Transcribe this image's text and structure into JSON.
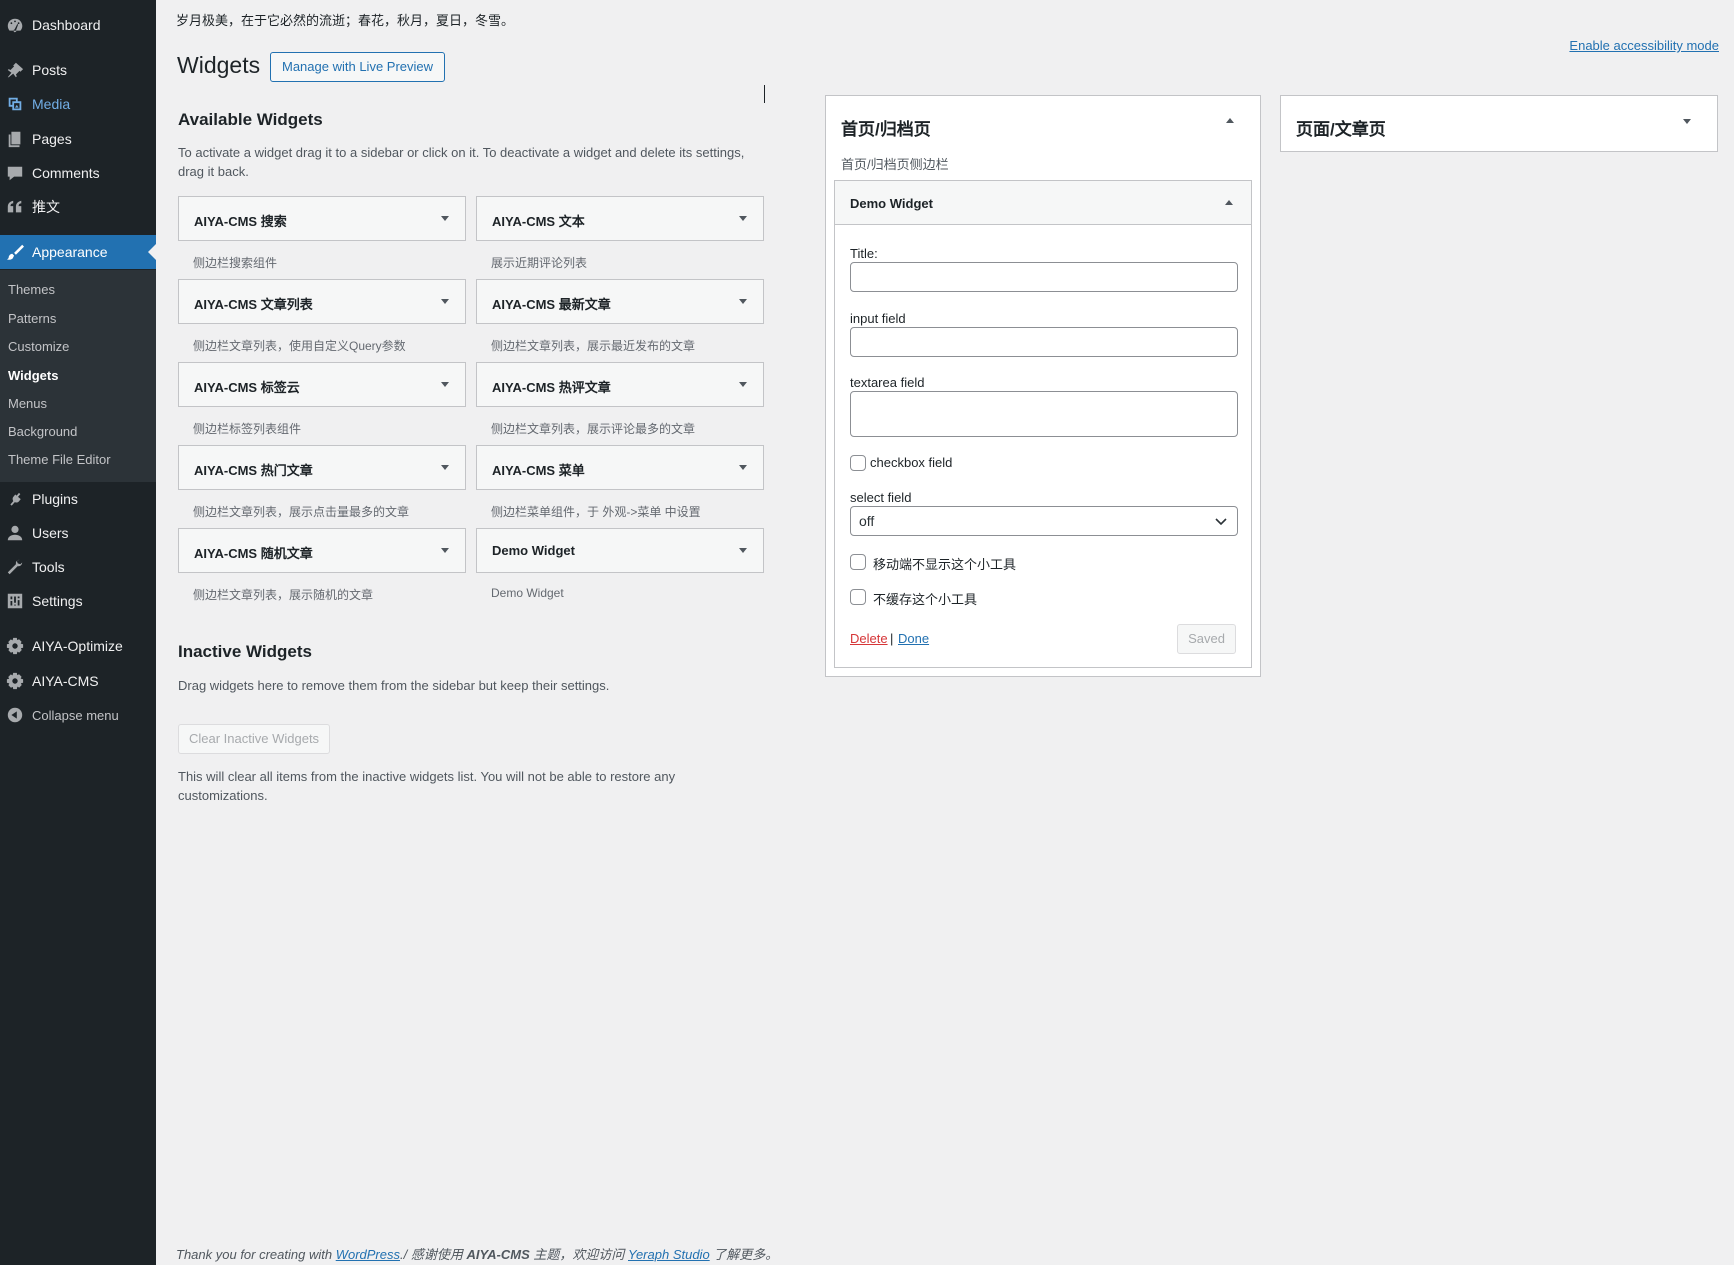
{
  "menu": {
    "dashboard": "Dashboard",
    "posts": "Posts",
    "media": "Media",
    "pages": "Pages",
    "comments": "Comments",
    "tweets": "推文",
    "appearance": "Appearance",
    "submenu": {
      "themes": "Themes",
      "patterns": "Patterns",
      "customize": "Customize",
      "widgets": "Widgets",
      "menus": "Menus",
      "background": "Background",
      "theme_file_editor": "Theme File Editor"
    },
    "plugins": "Plugins",
    "users": "Users",
    "tools": "Tools",
    "settings": "Settings",
    "aiya_optimize": "AIYA-Optimize",
    "aiya_cms": "AIYA-CMS",
    "collapse": "Collapse menu"
  },
  "header": {
    "tagline": "岁月极美，在于它必然的流逝；春花，秋月，夏日，冬雪。",
    "accessibility_link": "Enable accessibility mode",
    "title": "Widgets",
    "live_preview_button": "Manage with Live Preview"
  },
  "available": {
    "title": "Available Widgets",
    "description": "To activate a widget drag it to a sidebar or click on it. To deactivate a widget and delete its settings, drag it back.",
    "widgets": [
      {
        "title": "AIYA-CMS 搜索",
        "desc": "侧边栏搜索组件"
      },
      {
        "title": "AIYA-CMS 文本",
        "desc": "展示近期评论列表"
      },
      {
        "title": "AIYA-CMS 文章列表",
        "desc": "侧边栏文章列表，使用自定义Query参数"
      },
      {
        "title": "AIYA-CMS 最新文章",
        "desc": "侧边栏文章列表，展示最近发布的文章"
      },
      {
        "title": "AIYA-CMS 标签云",
        "desc": "侧边栏标签列表组件"
      },
      {
        "title": "AIYA-CMS 热评文章",
        "desc": "侧边栏文章列表，展示评论最多的文章"
      },
      {
        "title": "AIYA-CMS 热门文章",
        "desc": "侧边栏文章列表，展示点击量最多的文章"
      },
      {
        "title": "AIYA-CMS 菜单",
        "desc": "侧边栏菜单组件，于 外观->菜单 中设置"
      },
      {
        "title": "AIYA-CMS 随机文章",
        "desc": "侧边栏文章列表，展示随机的文章"
      },
      {
        "title": "Demo Widget",
        "desc": "Demo Widget"
      }
    ]
  },
  "inactive": {
    "title": "Inactive Widgets",
    "description": "Drag widgets here to remove them from the sidebar but keep their settings.",
    "clear_button": "Clear Inactive Widgets",
    "clear_note": "This will clear all items from the inactive widgets list. You will not be able to restore any customizations."
  },
  "sidebars": {
    "home": {
      "title": "首页/归档页",
      "description": "首页/归档页侧边栏",
      "widget": {
        "title": "Demo Widget",
        "fields": {
          "title_label": "Title:",
          "title_value": "",
          "input_label": "input field",
          "input_value": "",
          "textarea_label": "textarea field",
          "textarea_value": "",
          "checkbox_label": "checkbox field",
          "select_label": "select field",
          "select_value": "off",
          "hide_mobile_label": "移动端不显示这个小工具",
          "no_cache_label": "不缓存这个小工具"
        },
        "delete_link": "Delete",
        "separator": "|",
        "done_link": "Done",
        "saved_button": "Saved"
      }
    },
    "page": {
      "title": "页面/文章页"
    }
  },
  "footer": {
    "prefix": "Thank you for creating with ",
    "wordpress_link": "WordPress",
    "middle": "./ 感谢使用 ",
    "theme_name": "AIYA-CMS",
    "middle2": " 主题，欢迎访问 ",
    "studio_link": "Yeraph Studio",
    "suffix": " 了解更多。"
  },
  "colors": {
    "sidebar_bg": "#1d2327",
    "submenu_bg": "#2c3338",
    "accent": "#2271b1",
    "delete": "#d63638"
  },
  "icons": {
    "dashboard": "dashboard-icon",
    "posts": "pin-icon",
    "media": "media-icon",
    "pages": "pages-icon",
    "comments": "comment-icon",
    "tweets": "quote-icon",
    "appearance": "brush-icon",
    "plugins": "plugin-icon",
    "users": "user-icon",
    "tools": "wrench-icon",
    "settings": "settings-icon",
    "gear": "gear-icon",
    "collapse": "collapse-icon"
  }
}
